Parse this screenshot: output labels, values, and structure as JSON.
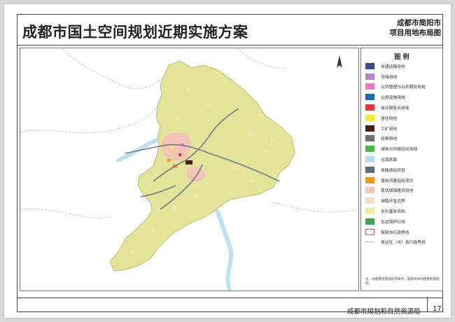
{
  "header": {
    "title": "成都市国土空间规划近期实施方案",
    "map_title_line1": "成都市简阳市",
    "map_title_line2": "项目用地布局图"
  },
  "footer": {
    "organization": "成都市规划和自然资源局",
    "page_number": "17"
  },
  "legend": {
    "title": "图    例",
    "items": [
      {
        "label": "交通运输用地",
        "color": "#3a4e86",
        "style": "fill"
      },
      {
        "label": "仓储用地",
        "color": "#b486c8",
        "style": "fill"
      },
      {
        "label": "公共管理与公共服务用地",
        "color": "#e77bbf",
        "style": "fill"
      },
      {
        "label": "公用设施用地",
        "color": "#1f6ab2",
        "style": "fill"
      },
      {
        "label": "商业服务业用地",
        "color": "#e33a3a",
        "style": "fill"
      },
      {
        "label": "居住用地",
        "color": "#f4e64a",
        "style": "fill"
      },
      {
        "label": "工矿用地",
        "color": "#4b1f12",
        "style": "fill"
      },
      {
        "label": "特殊用地",
        "color": "#6f6f6f",
        "style": "fill"
      },
      {
        "label": "绿地与开敞空间用地",
        "color": "#4fb449",
        "style": "fill"
      },
      {
        "label": "河湖水面",
        "color": "#b6dcef",
        "style": "fill"
      },
      {
        "label": "单独选址项目",
        "color": "#5b6e7a",
        "style": "fill"
      },
      {
        "label": "使用流量指标项目",
        "color": "#f2962e",
        "style": "fill"
      },
      {
        "label": "现状城镇建设用地",
        "color": "#f5c6b8",
        "style": "fill"
      },
      {
        "label": "城镇开发边界",
        "color": "#f6dfc4",
        "style": "fill"
      },
      {
        "label": "永久基本农田",
        "color": "#f1ea9a",
        "style": "fill"
      },
      {
        "label": "生态保护红线",
        "color": "#4d9b58",
        "style": "fill"
      },
      {
        "label": "简阳市行政界线",
        "color": "#e05050",
        "style": "outline"
      },
      {
        "label": "周边区（市）县行政界线",
        "color": "#b8b0c8",
        "style": "line"
      }
    ],
    "note": "注：除使用流量指标项目外，其余项目均使用新增指标。"
  },
  "map": {
    "county_fill": "#e3e39a",
    "county_border": "#c8c87a",
    "river_color": "#bfe0f0",
    "road_color": "#6d7a86",
    "urban_color": "#f3c3b5",
    "compass_letter": "N"
  }
}
